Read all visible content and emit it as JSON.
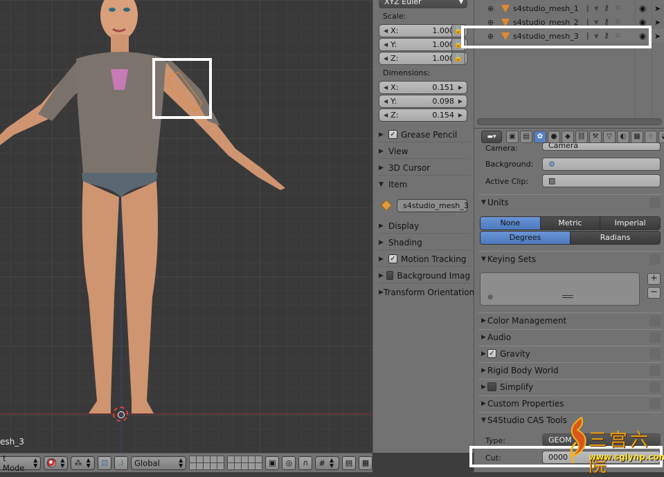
{
  "viewport": {
    "object_label": "esh_3"
  },
  "header": {
    "mode": "t Mode",
    "orientation": "Global"
  },
  "npanel": {
    "rotation_mode": "XYZ Euler",
    "scale_label": "Scale:",
    "scale": [
      {
        "axis": "X:",
        "value": "1.000"
      },
      {
        "axis": "Y:",
        "value": "1.000"
      },
      {
        "axis": "Z:",
        "value": "1.000"
      }
    ],
    "dimensions_label": "Dimensions:",
    "dimensions": [
      {
        "axis": "X:",
        "value": "0.151"
      },
      {
        "axis": "Y:",
        "value": "0.098"
      },
      {
        "axis": "Z:",
        "value": "0.154"
      }
    ],
    "sections": {
      "grease_pencil": "Grease Pencil",
      "view": "View",
      "cursor": "3D Cursor",
      "item": "Item",
      "item_name": "s4studio_mesh_3",
      "display": "Display",
      "shading": "Shading",
      "motion_tracking": "Motion Tracking",
      "background_images": "Background Imag",
      "transform_orientations": "Transform Orientation"
    }
  },
  "outliner": {
    "rows": [
      {
        "name": "s4studio_mesh_1"
      },
      {
        "name": "s4studio_mesh_2"
      },
      {
        "name": "s4studio_mesh_3"
      }
    ]
  },
  "properties": {
    "camera_label": "Camera:",
    "camera_value": "Camera",
    "background_label": "Background:",
    "active_clip_label": "Active Clip:",
    "units": {
      "title": "Units",
      "systems": [
        "None",
        "Metric",
        "Imperial"
      ],
      "rotation": [
        "Degrees",
        "Radians"
      ]
    },
    "keying_sets": "Keying Sets",
    "color_management": "Color Management",
    "audio": "Audio",
    "gravity": "Gravity",
    "rigid_body_world": "Rigid Body World",
    "simplify": "Simplify",
    "custom_properties": "Custom Properties",
    "s4s_tools": "S4Studio CAS Tools",
    "type_label": "Type:",
    "type_value": "GEOM",
    "cut_label": "Cut:",
    "cut_value": "0000"
  },
  "watermark": {
    "chars": "三宫六院",
    "url": "www.sglynp.com"
  },
  "colors": {
    "accent": "#5680c2",
    "highlight": "#ffffff",
    "mesh_orange": "#e38b2c"
  }
}
